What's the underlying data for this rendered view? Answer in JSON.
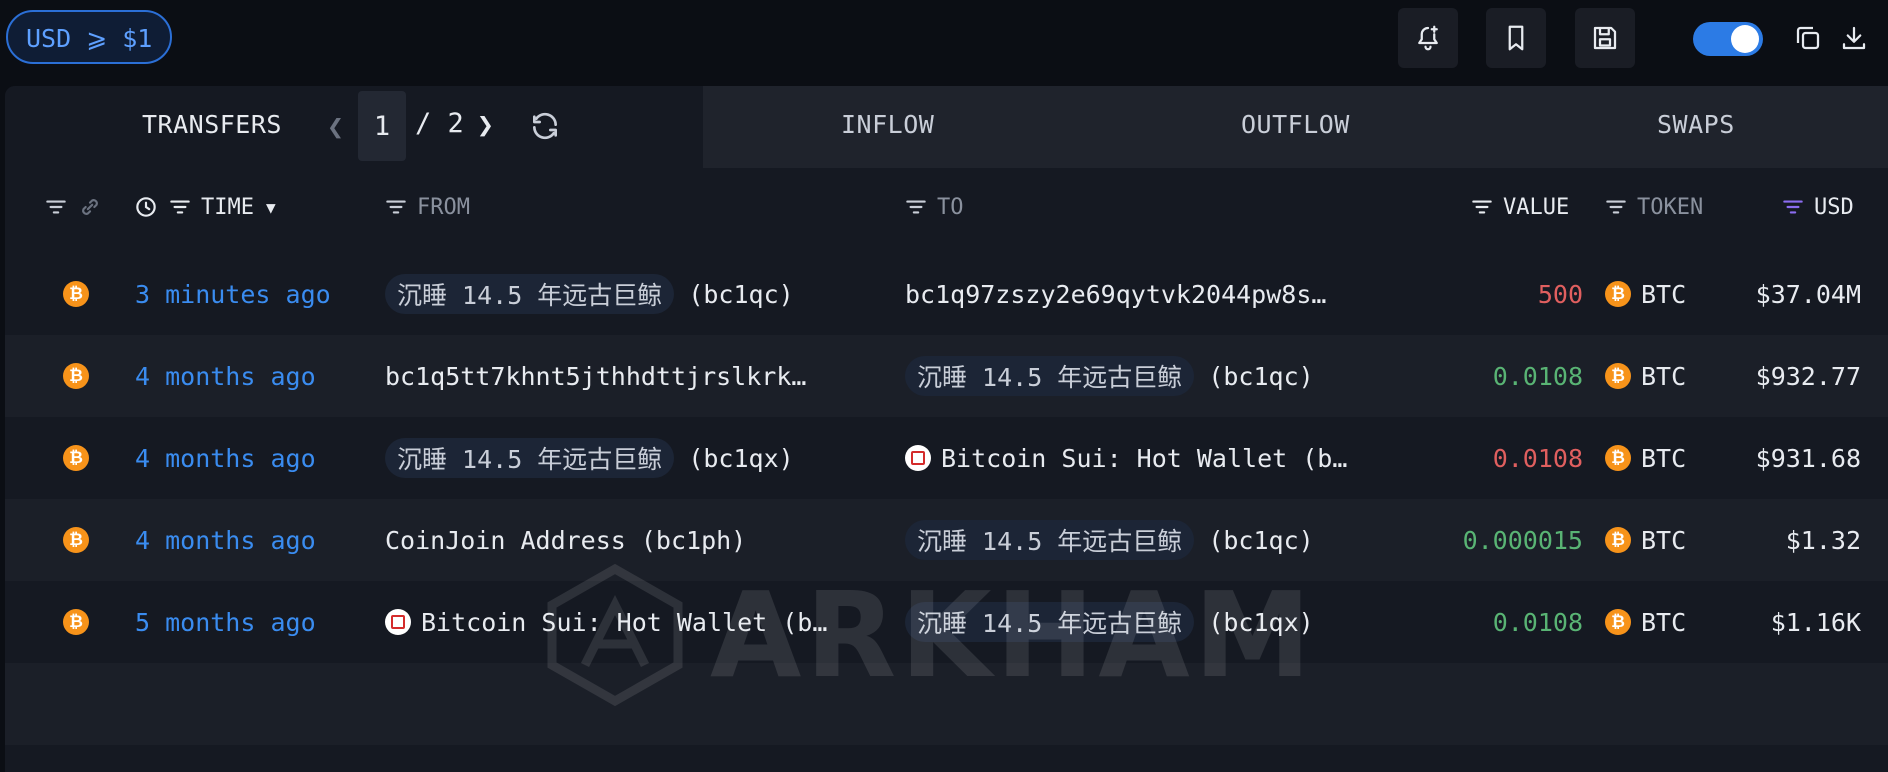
{
  "toolbar": {
    "filter_pill": "USD ⩾ $1",
    "icons": [
      "bell-plus-icon",
      "bookmark-icon",
      "save-icon",
      "toggle",
      "copy-icon",
      "download-icon"
    ],
    "toggle_on": true
  },
  "tabs": {
    "transfers_label": "TRANSFERS",
    "page_current": "1",
    "page_sep": "/ 2",
    "inflow": "INFLOW",
    "outflow": "OUTFLOW",
    "swaps": "SWAPS"
  },
  "columns": {
    "time": "TIME",
    "from": "FROM",
    "to": "TO",
    "value": "VALUE",
    "token": "TOKEN",
    "usd": "USD"
  },
  "rows": [
    {
      "time": "3 minutes ago",
      "from_chip": "沉睡 14.5 年远古巨鲸",
      "from_addr": "(bc1qc)",
      "to_text": "bc1q97zszy2e69qytvk2044pw8s…",
      "value": "500",
      "value_color": "#e05f5f",
      "token": "BTC",
      "usd": "$37.04M"
    },
    {
      "time": "4 months ago",
      "from_text": "bc1q5tt7khnt5jthhdttjrslkrk…",
      "to_chip": "沉睡 14.5 年远古巨鲸",
      "to_addr": "(bc1qc)",
      "value": "0.0108",
      "value_color": "#59b474",
      "token": "BTC",
      "usd": "$932.77"
    },
    {
      "time": "4 months ago",
      "from_chip": "沉睡 14.5 年远古巨鲸",
      "from_addr": "(bc1qx)",
      "to_text": "Bitcoin Sui: Hot Wallet (b…",
      "value": "0.0108",
      "value_color": "#e05f5f",
      "token": "BTC",
      "usd": "$931.68"
    },
    {
      "time": "4 months ago",
      "from_text": "CoinJoin Address (bc1ph)",
      "to_chip": "沉睡 14.5 年远古巨鲸",
      "to_addr": "(bc1qc)",
      "value": "0.000015",
      "value_color": "#59b474",
      "token": "BTC",
      "usd": "$1.32"
    },
    {
      "time": "5 months ago",
      "from_text": "Bitcoin Sui: Hot Wallet (b…",
      "to_chip": "沉睡 14.5 年远古巨鲸",
      "to_addr": "(bc1qx)",
      "value": "0.0108",
      "value_color": "#59b474",
      "token": "BTC",
      "usd": "$1.16K"
    }
  ],
  "watermark": "ARKHAM",
  "colors": {
    "accent": "#2c7be5",
    "time_link": "#3a8cf0",
    "btc": "#f7931a",
    "usd_filter_icon": "#8b6cf0"
  }
}
